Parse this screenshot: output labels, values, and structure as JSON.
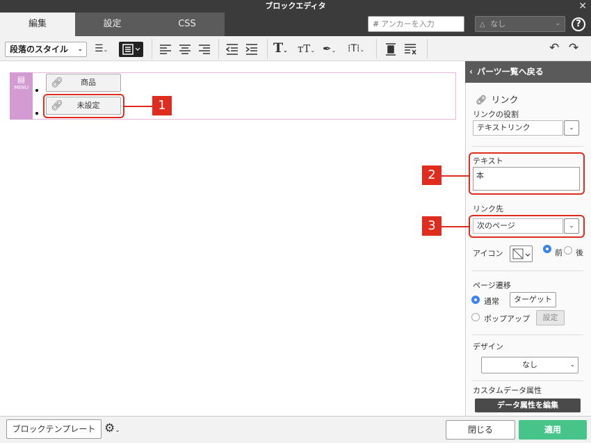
{
  "window": {
    "title": "ブロックエディタ",
    "close_glyph": "✕"
  },
  "tabs": [
    {
      "label": "編集",
      "active": true
    },
    {
      "label": "設定",
      "active": false
    },
    {
      "label": "CSS",
      "active": false
    }
  ],
  "header": {
    "anchor_placeholder": "アンカーを入力",
    "anchor_prefix": "#",
    "none_select_value": "なし",
    "help_glyph": "?"
  },
  "toolbar": {
    "paragraph_style_label": "段落のスタイル"
  },
  "editor": {
    "block_type_label": "MENU",
    "links": [
      {
        "label": "商品"
      },
      {
        "label": "未設定"
      }
    ]
  },
  "callouts": [
    "1",
    "2",
    "3"
  ],
  "panel": {
    "back_label": "パーツ一覧へ戻る",
    "section_title": "リンク",
    "link_role_label": "リンクの役割",
    "link_role_value": "テキストリンク",
    "text_label": "テキスト",
    "text_value": "本",
    "link_target_label": "リンク先",
    "link_target_value": "次のページ",
    "icon_label": "アイコン",
    "icon_before_label": "前",
    "icon_after_label": "後",
    "page_transition_label": "ページ遷移",
    "transition_normal_label": "通常",
    "target_button_label": "ターゲット",
    "transition_popup_label": "ポップアップ",
    "popup_settings_label": "設定",
    "design_label": "デザイン",
    "design_value": "なし",
    "custom_data_label": "カスタムデータ属性",
    "edit_data_attr_label": "データ属性を編集"
  },
  "footer": {
    "block_template_label": "ブロックテンプレート",
    "close_label": "閉じる",
    "apply_label": "適用"
  },
  "colors": {
    "accent": "#e02c1e",
    "apply": "#47c48a",
    "menu_block": "#d49ad2",
    "radio_on": "#3b82f6"
  }
}
